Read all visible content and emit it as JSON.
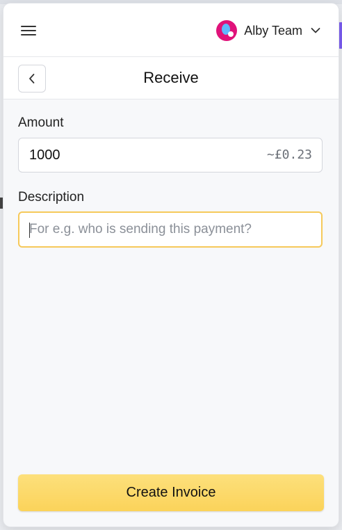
{
  "topbar": {
    "menu_icon": "hamburger-menu-icon",
    "account_name": "Alby Team",
    "account_dropdown_icon": "chevron-down-icon"
  },
  "header": {
    "title": "Receive",
    "back_icon": "chevron-left-icon"
  },
  "form": {
    "amount_label": "Amount",
    "amount_value": "1000",
    "fiat_value": "~£0.23",
    "description_label": "Description",
    "description_value": "",
    "description_placeholder": "For e.g. who is sending this payment?"
  },
  "actions": {
    "create_label": "Create Invoice"
  },
  "colors": {
    "accent": "#fbd35a",
    "focus_border": "#f6c95a",
    "avatar": "#e0127a"
  }
}
